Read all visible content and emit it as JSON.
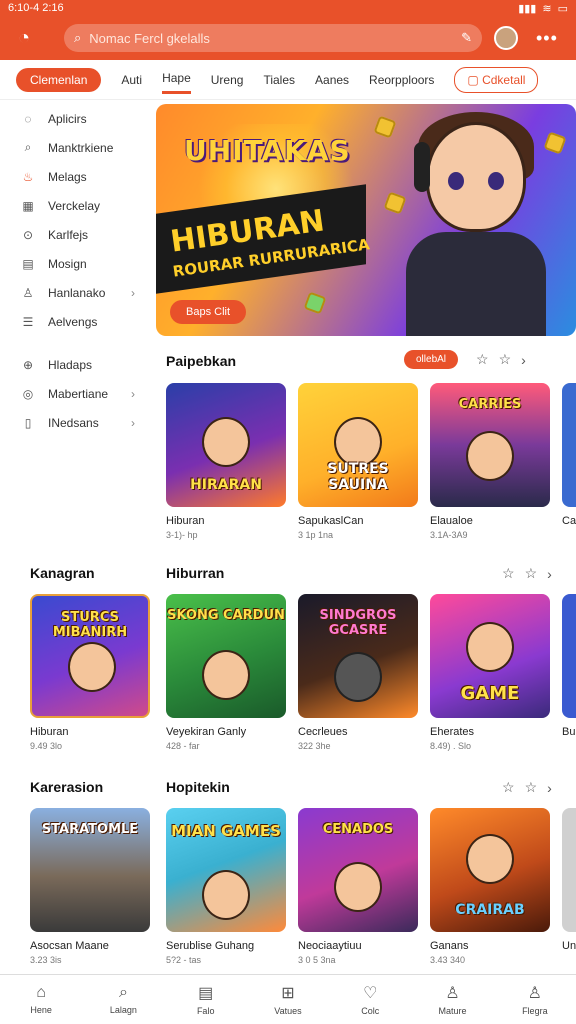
{
  "status": {
    "time": "6:10-4 2:16",
    "signal": "▮▮▮",
    "wifi": "≋",
    "battery": "▭"
  },
  "header": {
    "search_placeholder": "Nomac Fercl gkelalls"
  },
  "tabs": [
    "Clemenlan",
    "Auti",
    "Hape",
    "Ureng",
    "Tiales",
    "Aanes",
    "Reorpploors",
    "Cdketall"
  ],
  "sidebar": {
    "items": [
      {
        "label": "Aplicirs",
        "icon": "bulb-icon",
        "glyph": "◌"
      },
      {
        "label": "Manktrkiene",
        "icon": "search-icon",
        "glyph": "⌕"
      },
      {
        "label": "Melags",
        "icon": "flame-icon",
        "glyph": "♨"
      },
      {
        "label": "Verckelay",
        "icon": "calendar-icon",
        "glyph": "▦"
      },
      {
        "label": "Karlfejs",
        "icon": "gamepad-icon",
        "glyph": "⊙"
      },
      {
        "label": "Mosign",
        "icon": "document-icon",
        "glyph": "▤"
      },
      {
        "label": "Hanlanako",
        "icon": "user-icon",
        "glyph": "♙"
      },
      {
        "label": "Aelvengs",
        "icon": "list-icon",
        "glyph": "☰"
      }
    ],
    "items2": [
      {
        "label": "Hladaps",
        "icon": "lock-icon",
        "glyph": "⊕"
      },
      {
        "label": "Mabertiane",
        "icon": "shield-icon",
        "glyph": "◎"
      },
      {
        "label": "INedsans",
        "icon": "phone-icon",
        "glyph": "▯"
      }
    ]
  },
  "banner": {
    "logo": "UHITAKAS",
    "headline": "HIBURAN",
    "subline": "ROURAR RURRURARICA",
    "cta": "Baps Clit"
  },
  "section1": {
    "title": "Paipebkan",
    "pill": "ollebAl"
  },
  "section2": {
    "category": "Kanagran",
    "title": "Hiburran"
  },
  "section3": {
    "category": "Karerasion",
    "title": "Hopitekin"
  },
  "row1": [
    {
      "name": "Hiburan",
      "meta": "3-1)- hp",
      "art": "HIRARAN"
    },
    {
      "name": "SapukaslCan",
      "meta": "3 1p 1na",
      "art": "SUTRES SAUINA"
    },
    {
      "name": "Elaualoe",
      "meta": "3.1A-3A9",
      "art": "CARRIES"
    },
    {
      "name": "Ca",
      "meta": "",
      "art": ""
    }
  ],
  "row2": [
    {
      "name": "Hiburan",
      "meta": "9.49 3lo",
      "art": "STURCS MIBANIRH"
    },
    {
      "name": "Veyekiran Ganly",
      "meta": "428 - far",
      "art": "SKONG CARDUN"
    },
    {
      "name": "Cecrleues",
      "meta": "322 3he",
      "art": "SINDGROS GCASRE"
    },
    {
      "name": "Eherates",
      "meta": "8.49) . Slo",
      "art": "GAME"
    },
    {
      "name": "Bu",
      "meta": "",
      "art": ""
    }
  ],
  "row3": [
    {
      "name": "Asocsan Maane",
      "meta": "3.23 3is",
      "art": "STARATOMLE"
    },
    {
      "name": "Serublise Guhang",
      "meta": "5?2 - tas",
      "art": "MIAN GAMES"
    },
    {
      "name": "Neociaaytiuu",
      "meta": "3 0 5 3na",
      "art": "CENADOS"
    },
    {
      "name": "Ganans",
      "meta": "3.43 340",
      "art": "CRAIRAB"
    },
    {
      "name": "Un",
      "meta": "",
      "art": ""
    }
  ],
  "nav": [
    {
      "label": "Hene",
      "glyph": "⌂",
      "icon": "home-icon"
    },
    {
      "label": "Lalagn",
      "glyph": "⌕",
      "icon": "search-icon"
    },
    {
      "label": "Falo",
      "glyph": "▤",
      "icon": "list-icon"
    },
    {
      "label": "Vatues",
      "glyph": "⊞",
      "icon": "gift-icon"
    },
    {
      "label": "Colc",
      "glyph": "♡",
      "icon": "heart-icon"
    },
    {
      "label": "Mature",
      "glyph": "♙",
      "icon": "user-icon"
    },
    {
      "label": "Flegra",
      "glyph": "♙",
      "icon": "profile-icon"
    }
  ],
  "colors": {
    "accent": "#e8512a"
  }
}
